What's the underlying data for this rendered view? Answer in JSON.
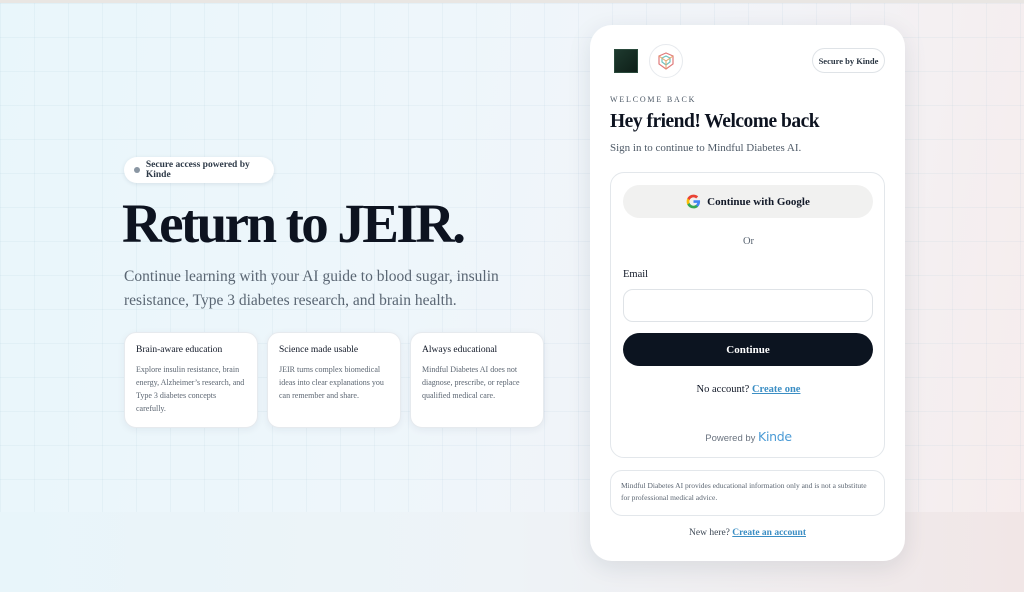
{
  "hero": {
    "badge": "Secure access powered by Kinde",
    "title": "Return to JEIR.",
    "subtitle": "Continue learning with your AI guide to blood sugar, insulin resistance, Type 3 diabetes research, and brain health.",
    "cards": [
      {
        "title": "Brain-aware education",
        "body": "Explore insulin resistance, brain energy, Alzheimer’s research, and Type 3 diabetes concepts carefully."
      },
      {
        "title": "Science made usable",
        "body": "JEIR turns complex biomedical ideas into clear explanations you can remember and share."
      },
      {
        "title": "Always educational",
        "body": "Mindful Diabetes AI does not diagnose, prescribe, or replace qualified medical care."
      }
    ]
  },
  "panel": {
    "secure_label": "Secure by Kinde",
    "eyebrow": "WELCOME BACK",
    "title": "Hey friend! Welcome back",
    "subtitle": "Sign in to continue to Mindful Diabetes AI.",
    "google_label": "Continue with Google",
    "or_label": "Or",
    "email_label": "Email",
    "email_value": "",
    "continue_label": "Continue",
    "no_account_text": "No account?",
    "create_one_label": "Create one",
    "powered_by": "Powered by",
    "kinde_logo": "Kinde",
    "disclaimer": "Mindful Diabetes AI provides educational information only and is not a substitute for professional medical advice.",
    "new_here_text": "New here?",
    "create_account_label": "Create an account"
  },
  "icons": {
    "dark_logo": "dark-square-logo-icon",
    "light_logo": "geometric-brain-logo-icon",
    "google": "google-g-icon"
  },
  "colors": {
    "primary_button": "#0c1420",
    "link": "#3b8ec4",
    "kinde_brand": "#4b9bd6"
  }
}
